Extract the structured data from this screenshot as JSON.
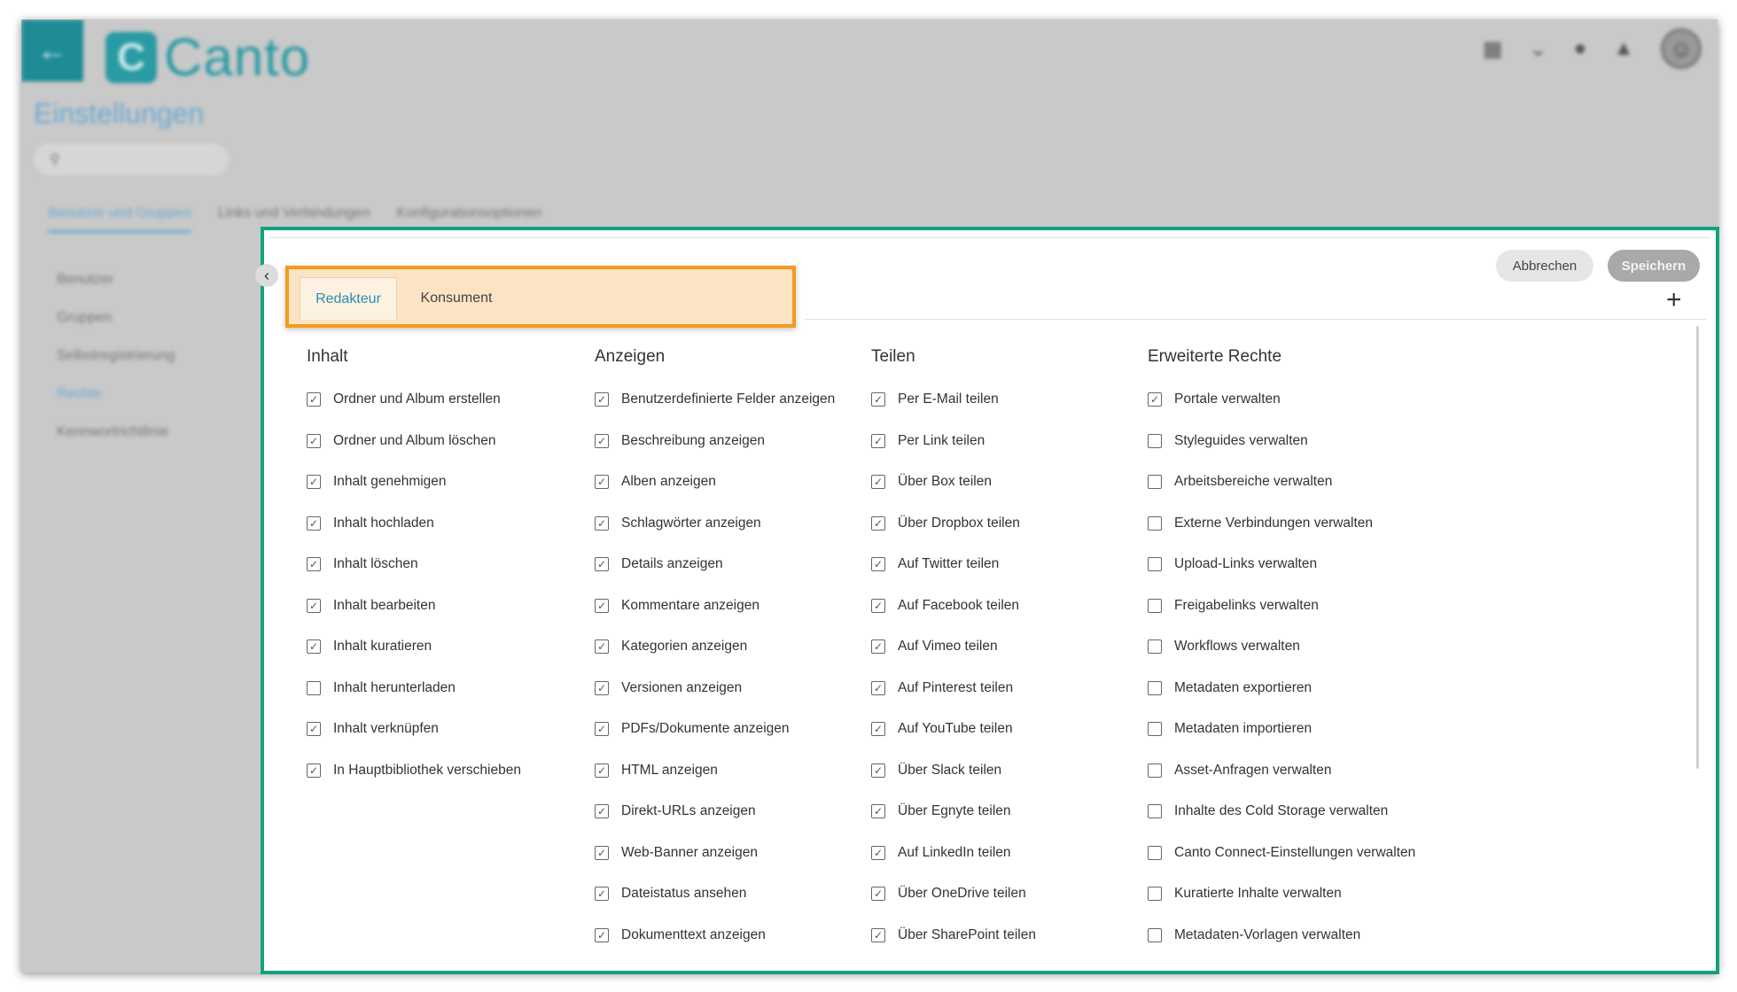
{
  "app": {
    "logo_text": "Canto",
    "back_icon": "arrow-left-icon",
    "page_title": "Einstellungen",
    "bg_tabs": [
      {
        "label": "Benutzer und Gruppen",
        "active": true
      },
      {
        "label": "Links und Verbindungen",
        "active": false
      },
      {
        "label": "Konfigurationsoptionen",
        "active": false
      }
    ],
    "sidebar": [
      "Benutzer",
      "Gruppen",
      "Selbstregistrierung",
      "Rechte",
      "Kennwortrichtlinie"
    ]
  },
  "panel": {
    "tabs": [
      "Redakteur",
      "Konsument"
    ],
    "active_tab": "Redakteur",
    "cancel_label": "Abbrechen",
    "save_label": "Speichern",
    "add_symbol": "+",
    "collapse_symbol": "‹",
    "columns": [
      {
        "title": "Inhalt",
        "items": [
          {
            "label": "Ordner und Album erstellen",
            "checked": true
          },
          {
            "label": "Ordner und Album löschen",
            "checked": true
          },
          {
            "label": "Inhalt genehmigen",
            "checked": true
          },
          {
            "label": "Inhalt hochladen",
            "checked": true
          },
          {
            "label": "Inhalt löschen",
            "checked": true
          },
          {
            "label": "Inhalt bearbeiten",
            "checked": true
          },
          {
            "label": "Inhalt kuratieren",
            "checked": true
          },
          {
            "label": "Inhalt herunterladen",
            "checked": false
          },
          {
            "label": "Inhalt verknüpfen",
            "checked": true
          },
          {
            "label": "In Hauptbibliothek verschieben",
            "checked": true
          }
        ]
      },
      {
        "title": "Anzeigen",
        "items": [
          {
            "label": "Benutzerdefinierte Felder anzeigen",
            "checked": true
          },
          {
            "label": "Beschreibung anzeigen",
            "checked": true
          },
          {
            "label": "Alben anzeigen",
            "checked": true
          },
          {
            "label": "Schlagwörter anzeigen",
            "checked": true
          },
          {
            "label": "Details anzeigen",
            "checked": true
          },
          {
            "label": "Kommentare anzeigen",
            "checked": true
          },
          {
            "label": "Kategorien anzeigen",
            "checked": true
          },
          {
            "label": "Versionen anzeigen",
            "checked": true
          },
          {
            "label": "PDFs/Dokumente anzeigen",
            "checked": true
          },
          {
            "label": "HTML anzeigen",
            "checked": true
          },
          {
            "label": "Direkt-URLs anzeigen",
            "checked": true
          },
          {
            "label": "Web-Banner anzeigen",
            "checked": true
          },
          {
            "label": "Dateistatus ansehen",
            "checked": true
          },
          {
            "label": "Dokumenttext anzeigen",
            "checked": true
          }
        ]
      },
      {
        "title": "Teilen",
        "items": [
          {
            "label": "Per E-Mail teilen",
            "checked": true
          },
          {
            "label": "Per Link teilen",
            "checked": true
          },
          {
            "label": "Über Box teilen",
            "checked": true
          },
          {
            "label": "Über Dropbox teilen",
            "checked": true
          },
          {
            "label": "Auf Twitter teilen",
            "checked": true
          },
          {
            "label": "Auf Facebook teilen",
            "checked": true
          },
          {
            "label": "Auf Vimeo teilen",
            "checked": true
          },
          {
            "label": "Auf Pinterest teilen",
            "checked": true
          },
          {
            "label": "Auf YouTube teilen",
            "checked": true
          },
          {
            "label": "Über Slack teilen",
            "checked": true
          },
          {
            "label": "Über Egnyte teilen",
            "checked": true
          },
          {
            "label": "Auf LinkedIn teilen",
            "checked": true
          },
          {
            "label": "Über OneDrive teilen",
            "checked": true
          },
          {
            "label": "Über SharePoint teilen",
            "checked": true
          }
        ]
      },
      {
        "title": "Erweiterte Rechte",
        "items": [
          {
            "label": "Portale verwalten",
            "checked": true
          },
          {
            "label": "Styleguides verwalten",
            "checked": false
          },
          {
            "label": "Arbeitsbereiche verwalten",
            "checked": false
          },
          {
            "label": "Externe Verbindungen verwalten",
            "checked": false
          },
          {
            "label": "Upload-Links verwalten",
            "checked": false
          },
          {
            "label": "Freigabelinks verwalten",
            "checked": false
          },
          {
            "label": "Workflows verwalten",
            "checked": false
          },
          {
            "label": "Metadaten exportieren",
            "checked": false
          },
          {
            "label": "Metadaten importieren",
            "checked": false
          },
          {
            "label": "Asset-Anfragen verwalten",
            "checked": false
          },
          {
            "label": "Inhalte des Cold Storage verwalten",
            "checked": false
          },
          {
            "label": "Canto Connect-Einstellungen verwalten",
            "checked": false
          },
          {
            "label": "Kuratierte Inhalte verwalten",
            "checked": false
          },
          {
            "label": "Metadaten-Vorlagen verwalten",
            "checked": false
          }
        ]
      }
    ]
  }
}
